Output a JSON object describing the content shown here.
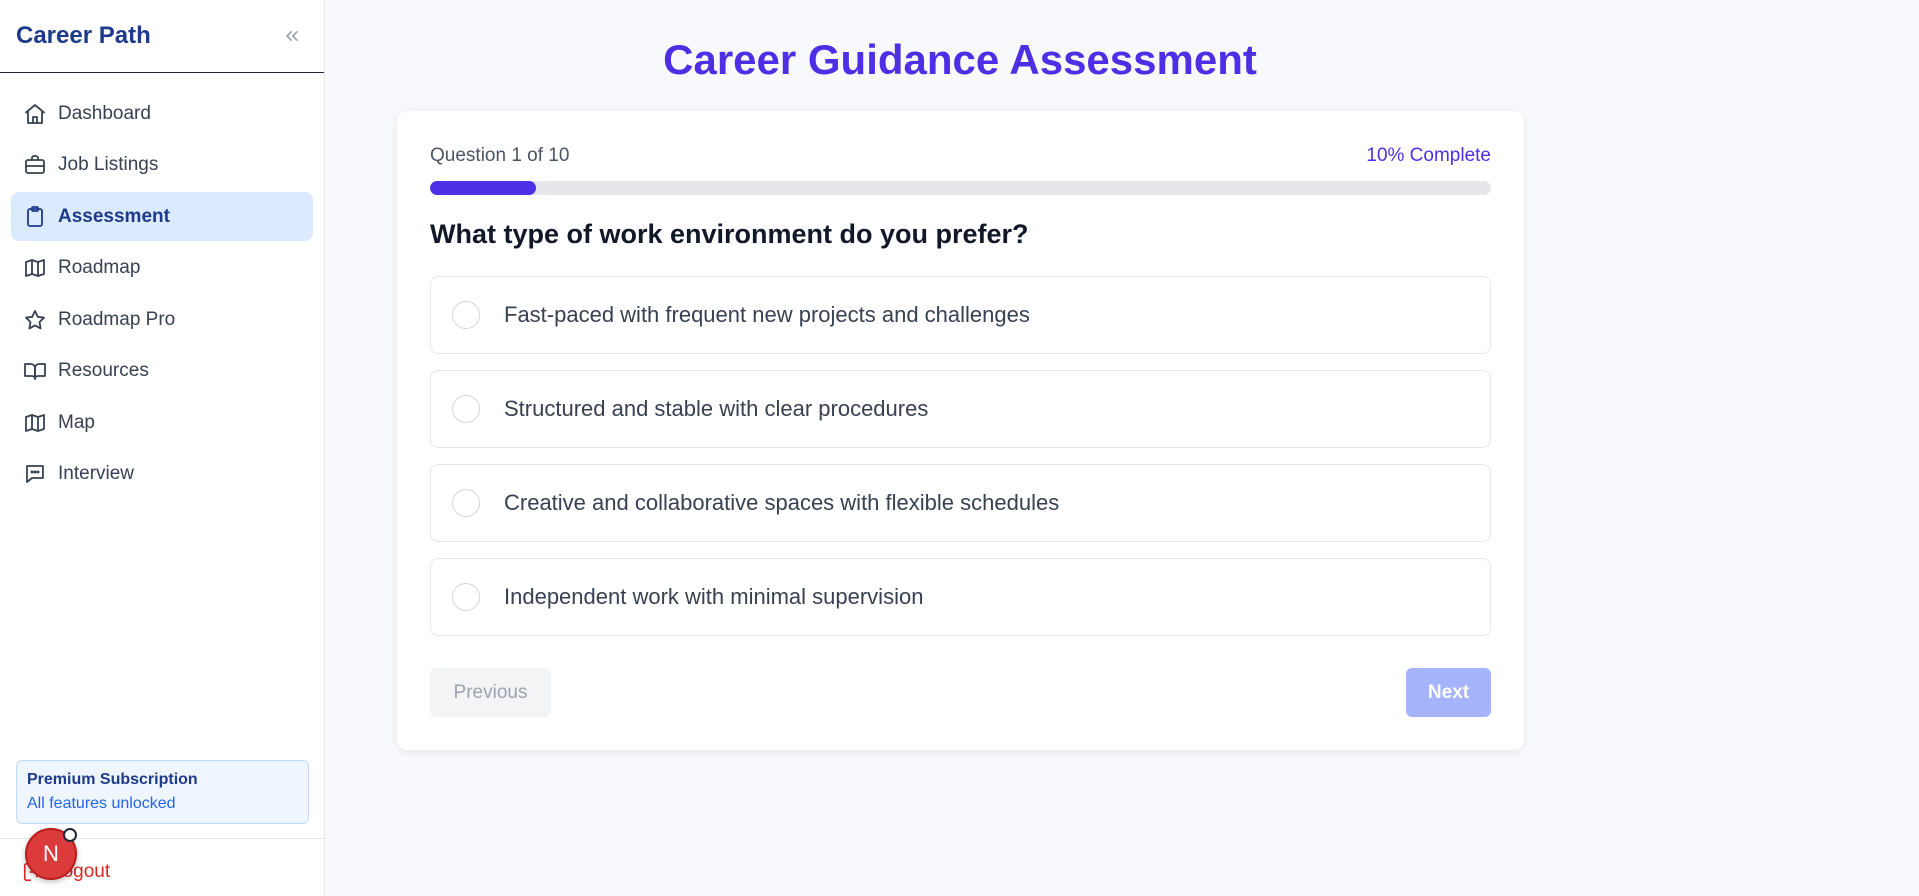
{
  "sidebar": {
    "brand": "Career Path",
    "collapse_icon": "chevrons-left-icon",
    "items": [
      {
        "label": "Dashboard",
        "icon": "home-icon",
        "active": false
      },
      {
        "label": "Job Listings",
        "icon": "briefcase-icon",
        "active": false
      },
      {
        "label": "Assessment",
        "icon": "clipboard-icon",
        "active": true
      },
      {
        "label": "Roadmap",
        "icon": "map-icon",
        "active": false
      },
      {
        "label": "Roadmap Pro",
        "icon": "star-icon",
        "active": false
      },
      {
        "label": "Resources",
        "icon": "book-open-icon",
        "active": false
      },
      {
        "label": "Map",
        "icon": "map-icon",
        "active": false
      },
      {
        "label": "Interview",
        "icon": "message-icon",
        "active": false
      }
    ],
    "premium": {
      "title": "Premium Subscription",
      "subtitle": "All features unlocked"
    },
    "logout_label": "Logout",
    "avatar_initial": "N"
  },
  "main": {
    "title": "Career Guidance Assessment",
    "question_counter": "Question 1 of 10",
    "complete_label": "10% Complete",
    "progress_fraction": 0.1,
    "question": "What type of work environment do you prefer?",
    "options": [
      "Fast-paced with frequent new projects and challenges",
      "Structured and stable with clear procedures",
      "Creative and collaborative spaces with flexible schedules",
      "Independent work with minimal supervision"
    ],
    "previous_label": "Previous",
    "next_label": "Next"
  },
  "colors": {
    "accent": "#4f2fe6",
    "brand": "#1e3a8a",
    "active_bg": "#dbeafe",
    "logout": "#dc2626",
    "next_disabled": "#a5b4fc"
  }
}
